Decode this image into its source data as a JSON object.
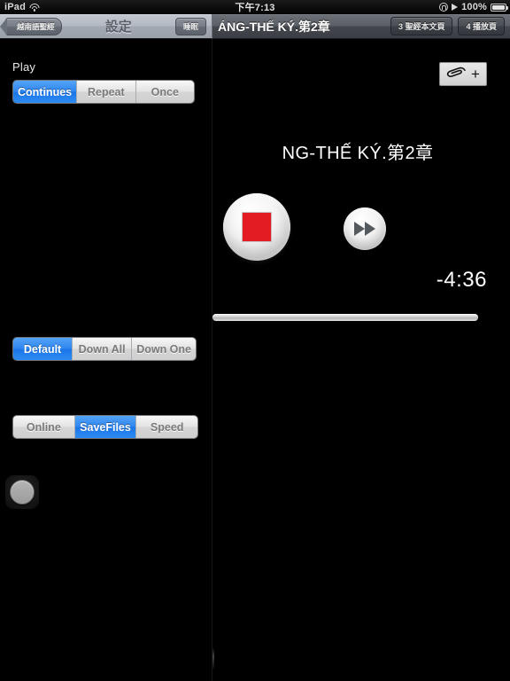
{
  "statusbar": {
    "device": "iPad",
    "wifi_icon": "wifi-icon",
    "time": "下午7:13",
    "rotation_lock_icon": "rotation-lock-icon",
    "play_icon": "play-icon",
    "battery_percent": "100%",
    "battery_icon": "battery-icon"
  },
  "master_nav": {
    "back_label": "越南語聖經",
    "title": "設定",
    "sleep_label": "睡眠"
  },
  "detail_nav": {
    "title": "ÁNG-THẾ KÝ.第2章",
    "buttons": [
      {
        "label": "3 聖經本文頁"
      },
      {
        "label": "4 播放頁"
      }
    ]
  },
  "settings": {
    "play_label": "Play",
    "play_mode": {
      "options": [
        "Continues",
        "Repeat",
        "Once"
      ],
      "selected": 0
    },
    "download_mode": {
      "options": [
        "Default",
        "Down All",
        "Down One"
      ],
      "selected": 0
    },
    "source_mode": {
      "options": [
        "Online",
        "SaveFiles",
        "Speed"
      ],
      "selected": 1
    },
    "knob_name": "volume-knob"
  },
  "player": {
    "attach_icon": "paperclip-icon",
    "attach_plus": "+",
    "chapter_title": "NG-THẾ KÝ.第2章",
    "stop_icon": "stop-icon",
    "fast_forward_icon": "fast-forward-icon",
    "time_remaining": "-4:36",
    "progress_percent": 0
  },
  "colors": {
    "accent_blue": "#2f86ef",
    "stop_red": "#e31b23",
    "background": "#000000"
  }
}
